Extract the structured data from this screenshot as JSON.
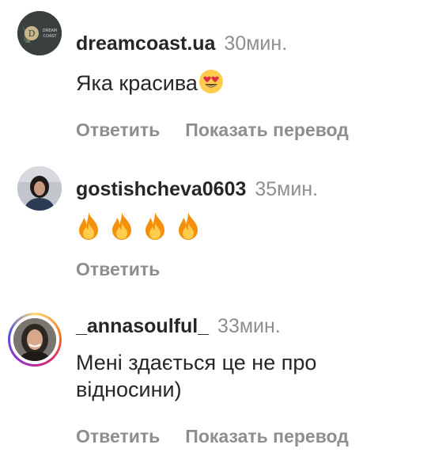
{
  "comments": [
    {
      "username": "dreamcoast.ua",
      "time": "30мин.",
      "text": "Яка красива",
      "text_emoji": "heart-eyes-emoji",
      "avatar_logo_text": "DREAM COAST",
      "actions": {
        "reply": "Ответить",
        "translate": "Показать перевод"
      }
    },
    {
      "username": "gostishcheva0603",
      "time": "35мин.",
      "fire_count": 4,
      "text_emoji": "fire-emoji",
      "actions": {
        "reply": "Ответить"
      }
    },
    {
      "username": "_annasoulful_",
      "time": "33мин.",
      "text": "Мені здається це не про відносини)",
      "actions": {
        "reply": "Ответить",
        "translate": "Показать перевод"
      }
    }
  ],
  "colors": {
    "username": "#262626",
    "secondary": "#8e8e8e",
    "story_ring": [
      "#feda75",
      "#fa7e1e",
      "#d62976",
      "#962fbf",
      "#4f5bd5"
    ]
  }
}
